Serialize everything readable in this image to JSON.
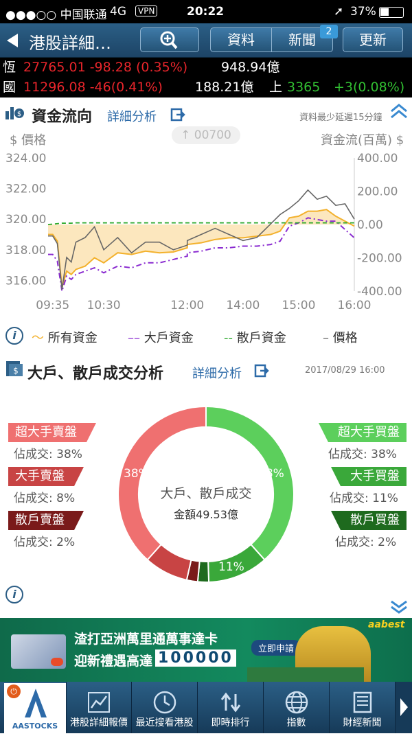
{
  "status_bar": {
    "carrier": "●●●○○ 中国联通",
    "network": "4G",
    "vpn": "VPN",
    "time": "20:22",
    "battery": "37%"
  },
  "nav": {
    "back_icon": "back-arrow-icon",
    "title": "港股詳細…",
    "search_icon": "magnifier-plus-icon",
    "tabs": [
      "資料",
      "新聞"
    ],
    "news_badge": "2",
    "refresh": "更新"
  },
  "index_bar": {
    "hsi_label": "恆",
    "hsi_value": "27765.01 -98.28 (0.35%)",
    "hsi_turnover": "948.94億",
    "hscei_label": "國",
    "hscei_value": "11296.08 -46(0.41%)",
    "hscei_turnover": "188.21億",
    "up_label": "上",
    "up_value": "3365",
    "up_change": "+3(0.08%)"
  },
  "fund_flow": {
    "title": "資金流向",
    "detail_link": "詳細分析",
    "delay_note": "資料最少延遲15分鐘",
    "price_label": "$ 價格",
    "stock_code": "00700",
    "flow_label": "資金流(百萬) $"
  },
  "legend": {
    "items": [
      "所有資金",
      "大戶資金",
      "散戶資金",
      "價格"
    ]
  },
  "chart_data": {
    "type": "line",
    "x": [
      "09:30",
      "09:35",
      "09:40",
      "09:45",
      "09:50",
      "09:55",
      "10:00",
      "10:10",
      "10:20",
      "10:30",
      "10:45",
      "11:00",
      "11:15",
      "11:30",
      "11:45",
      "12:00",
      "13:00",
      "13:15",
      "13:30",
      "13:45",
      "14:00",
      "14:15",
      "14:30",
      "14:40",
      "14:50",
      "15:00",
      "15:10",
      "15:20",
      "15:30",
      "15:40",
      "15:50",
      "16:00"
    ],
    "x_ticks": [
      "09:35",
      "10:30",
      "12:00",
      "14:00",
      "15:00",
      "16:00"
    ],
    "y_left_ticks": [
      "324.00",
      "322.00",
      "320.00",
      "318.00",
      "316.00"
    ],
    "y_right_ticks": [
      "400.00",
      "200.00",
      "0.00",
      "-200.00",
      "-400.00"
    ],
    "y_left_lim": [
      315.3,
      324.0
    ],
    "y_right_lim": [
      -400,
      400
    ],
    "series": [
      {
        "name": "所有資金",
        "axis": "right",
        "color": "#f3b12c",
        "values": [
          -60,
          -60,
          -100,
          -380,
          -280,
          -300,
          -270,
          -250,
          -200,
          -230,
          -170,
          -180,
          -160,
          -170,
          -165,
          -140,
          -120,
          -110,
          -90,
          -80,
          -80,
          -70,
          -60,
          -40,
          40,
          50,
          80,
          80,
          90,
          50,
          20,
          -10
        ]
      },
      {
        "name": "大戶資金",
        "axis": "right",
        "color": "#8a2bd0",
        "values": [
          -180,
          -180,
          -220,
          -400,
          -310,
          -330,
          -300,
          -280,
          -260,
          -290,
          -250,
          -260,
          -230,
          -230,
          -210,
          -190,
          -170,
          -160,
          -140,
          -140,
          -130,
          -130,
          -120,
          -100,
          -10,
          10,
          40,
          30,
          20,
          20,
          -30,
          -80
        ]
      },
      {
        "name": "散戶資金",
        "axis": "right",
        "color": "#2faa2f",
        "values": [
          0,
          2,
          5,
          8,
          8,
          8,
          10,
          10,
          10,
          10,
          10,
          10,
          10,
          10,
          10,
          10,
          10,
          10,
          10,
          10,
          10,
          10,
          10,
          10,
          10,
          10,
          10,
          10,
          10,
          10,
          10,
          10
        ]
      },
      {
        "name": "價格",
        "axis": "left",
        "color": "#666666",
        "values": [
          318.9,
          318.9,
          318.4,
          315.4,
          317.5,
          317.2,
          318.5,
          318.8,
          319.5,
          318.0,
          318.8,
          317.8,
          318.5,
          318.5,
          318.0,
          318.3,
          318.6,
          319.0,
          319.4,
          319.0,
          318.6,
          318.8,
          319.7,
          320.3,
          320.7,
          321.2,
          321.9,
          321.3,
          321.5,
          320.9,
          321.0,
          320.0
        ]
      }
    ]
  },
  "trade_analysis": {
    "title": "大戶、散戶成交分析",
    "detail_link": "詳細分析",
    "timestamp": "2017/08/29 16:00",
    "center_title": "大戶、散戶成交",
    "center_amount": "金額49.53億",
    "share_label": "佔成交:",
    "sell": [
      {
        "label": "超大手賣盤",
        "pct": "38%",
        "color": "#ef7070"
      },
      {
        "label": "大手賣盤",
        "pct": "8%",
        "color": "#c84444"
      },
      {
        "label": "散戶賣盤",
        "pct": "2%",
        "color": "#7a1a1a"
      }
    ],
    "buy": [
      {
        "label": "超大手買盤",
        "pct": "38%",
        "color": "#5ccf5c"
      },
      {
        "label": "大手買盤",
        "pct": "11%",
        "color": "#3aa83a"
      },
      {
        "label": "散戶買盤",
        "pct": "2%",
        "color": "#1e6a1e"
      }
    ],
    "donut_labels": {
      "sell_big": "38%",
      "buy_big": "38%",
      "buy_large": "11%"
    }
  },
  "ad_banner": {
    "line1": "渣打亞洲萬里通萬事達卡",
    "line2": "迎新禮遇高達",
    "amount": "100000",
    "cta": "立即申請",
    "brand": "aabest"
  },
  "tab_bar": {
    "logo": "AASTOCKS",
    "tabs": [
      "港股詳細報價",
      "最近搜看港股",
      "即時排行",
      "指數",
      "財經新聞"
    ]
  }
}
